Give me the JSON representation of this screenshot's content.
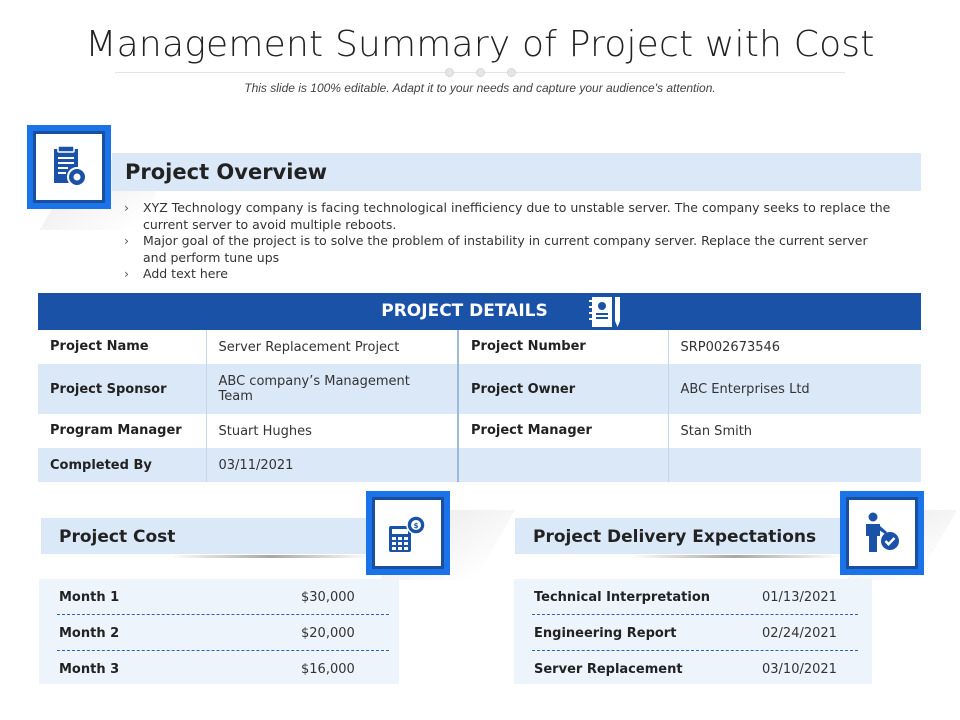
{
  "title": "Management Summary of Project with Cost",
  "subtitle": "This slide is 100% editable. Adapt it to your needs and capture your audience's attention.",
  "overview": {
    "heading": "Project Overview",
    "icon": "document-gear-icon",
    "bullets": [
      "XYZ Technology company is facing technological inefficiency due to unstable server. The company seeks to replace the current server to avoid multiple reboots.",
      "Major goal of the project is to solve the problem of instability in current company server. Replace the current server and perform tune ups",
      "Add text here"
    ]
  },
  "details": {
    "heading": "PROJECT DETAILS",
    "icon": "notebook-pen-icon",
    "rows": [
      {
        "label1": "Project Name",
        "value1": "Server Replacement Project",
        "label2": "Project Number",
        "value2": "SRP002673546"
      },
      {
        "label1": "Project Sponsor",
        "value1": "ABC company’s Management Team",
        "label2": "Project Owner",
        "value2": "ABC Enterprises Ltd"
      },
      {
        "label1": "Program Manager",
        "value1": "Stuart Hughes",
        "label2": "Project Manager",
        "value2": "Stan Smith"
      },
      {
        "label1": "Completed By",
        "value1": "03/11/2021",
        "label2": "",
        "value2": ""
      }
    ]
  },
  "cost": {
    "heading": "Project Cost",
    "icon": "calculator-gear-icon",
    "rows": [
      {
        "label": "Month 1",
        "value": "$30,000"
      },
      {
        "label": "Month 2",
        "value": "$20,000"
      },
      {
        "label": "Month 3",
        "value": "$16,000"
      }
    ]
  },
  "delivery": {
    "heading": "Project Delivery Expectations",
    "icon": "person-check-icon",
    "rows": [
      {
        "label": "Technical Interpretation",
        "value": "01/13/2021"
      },
      {
        "label": "Engineering Report",
        "value": "02/24/2021"
      },
      {
        "label": "Server Replacement",
        "value": "03/10/2021"
      }
    ]
  },
  "colors": {
    "accent": "#1a73e8",
    "header": "#1a52a7",
    "band": "#dbe8f8"
  }
}
